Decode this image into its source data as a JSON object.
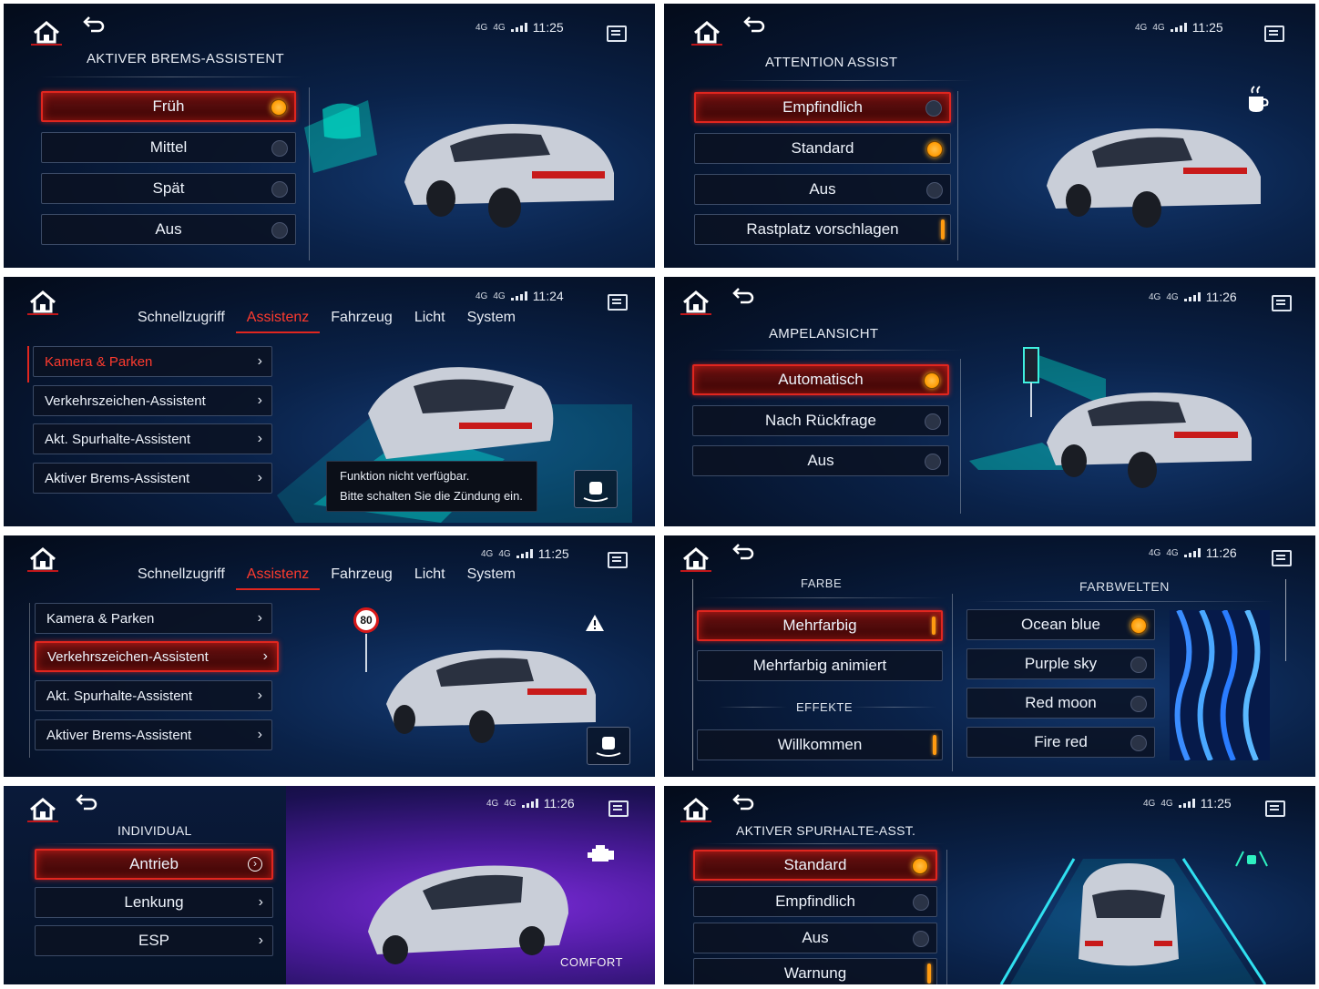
{
  "status": {
    "net_a": "4G",
    "net_b": "4G",
    "times": [
      "11:25",
      "11:25",
      "11:24",
      "11:26",
      "11:25",
      "11:26",
      "11:26",
      "11:25"
    ]
  },
  "panel1": {
    "title": "AKTIVER BREMS-ASSISTENT",
    "options": [
      {
        "label": "Früh",
        "state": "selected"
      },
      {
        "label": "Mittel",
        "state": "off"
      },
      {
        "label": "Spät",
        "state": "off"
      },
      {
        "label": "Aus",
        "state": "off"
      }
    ]
  },
  "panel2": {
    "title": "ATTENTION ASSIST",
    "options": [
      {
        "label": "Empfindlich",
        "state": "off"
      },
      {
        "label": "Standard",
        "state": "selected"
      },
      {
        "label": "Aus",
        "state": "off"
      },
      {
        "label": "Rastplatz vorschlagen",
        "state": "toggle-on"
      }
    ],
    "icon": "coffee-cup-icon"
  },
  "panel3": {
    "tabs": [
      "Schnellzugriff",
      "Assistenz",
      "Fahrzeug",
      "Licht",
      "System"
    ],
    "active_tab": "Assistenz",
    "items": [
      "Kamera & Parken",
      "Verkehrszeichen-Assistent",
      "Akt. Spurhalte-Assistent",
      "Aktiver Brems-Assistent"
    ],
    "tooltip_line1": "Funktion nicht verfügbar.",
    "tooltip_line2": "Bitte schalten Sie die Zündung ein."
  },
  "panel4": {
    "title": "AMPELANSICHT",
    "options": [
      {
        "label": "Automatisch",
        "state": "selected"
      },
      {
        "label": "Nach Rückfrage",
        "state": "off"
      },
      {
        "label": "Aus",
        "state": "off"
      }
    ]
  },
  "panel5": {
    "tabs": [
      "Schnellzugriff",
      "Assistenz",
      "Fahrzeug",
      "Licht",
      "System"
    ],
    "active_tab": "Assistenz",
    "items": [
      "Kamera & Parken",
      "Verkehrszeichen-Assistent",
      "Akt. Spurhalte-Assistent",
      "Aktiver Brems-Assistent"
    ],
    "speed_sign": "80"
  },
  "panel6": {
    "farbe_title": "FARBE",
    "farbwelten_title": "FARBWELTEN",
    "effekte_title": "EFFEKTE",
    "farbe_options": [
      {
        "label": "Mehrfarbig",
        "state": "toggle-on"
      },
      {
        "label": "Mehrfarbig animiert",
        "state": "none"
      }
    ],
    "effekte_options": [
      {
        "label": "Willkommen",
        "state": "toggle-on"
      }
    ],
    "farbwelten_options": [
      {
        "label": "Ocean blue",
        "state": "selected"
      },
      {
        "label": "Purple sky",
        "state": "off"
      },
      {
        "label": "Red moon",
        "state": "off"
      },
      {
        "label": "Fire red",
        "state": "off"
      }
    ]
  },
  "panel7": {
    "title": "INDIVIDUAL",
    "items": [
      "Antrieb",
      "Lenkung",
      "ESP"
    ],
    "mode": "COMFORT"
  },
  "panel8": {
    "title": "AKTIVER SPURHALTE-ASST.",
    "options": [
      {
        "label": "Standard",
        "state": "selected"
      },
      {
        "label": "Empfindlich",
        "state": "off"
      },
      {
        "label": "Aus",
        "state": "off"
      },
      {
        "label": "Warnung",
        "state": "toggle-on"
      }
    ]
  }
}
